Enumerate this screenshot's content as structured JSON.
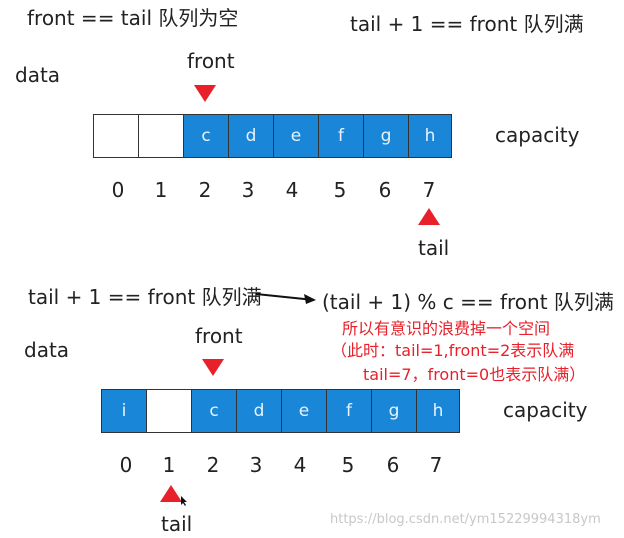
{
  "top": {
    "empty_condition": "front == tail 队列为空",
    "full_condition": "tail + 1 == front 队列满",
    "data_label": "data",
    "front_label": "front",
    "capacity_label": "capacity",
    "tail_label": "tail",
    "cells": [
      "",
      "",
      "c",
      "d",
      "e",
      "f",
      "g",
      "h"
    ],
    "indices": [
      "0",
      "1",
      "2",
      "3",
      "4",
      "5",
      "6",
      "7"
    ]
  },
  "bottom": {
    "full_condition": "tail + 1 == front 队列满",
    "mod_condition": "(tail + 1) % c == front 队列满",
    "note_line1": "所以有意识的浪费掉一个空间",
    "note_line2": "（此时：tail=1,front=2表示队满",
    "note_line3": "tail=7，front=0也表示队满）",
    "data_label": "data",
    "front_label": "front",
    "capacity_label": "capacity",
    "tail_label": "tail",
    "cells": [
      "i",
      "",
      "c",
      "d",
      "e",
      "f",
      "g",
      "h"
    ],
    "indices": [
      "0",
      "1",
      "2",
      "3",
      "4",
      "5",
      "6",
      "7"
    ]
  },
  "colors": {
    "accent_blue": "#1a86d8",
    "pointer_red": "#e8202a"
  },
  "watermark": "https://blog.csdn.net/ym15229994318ym"
}
